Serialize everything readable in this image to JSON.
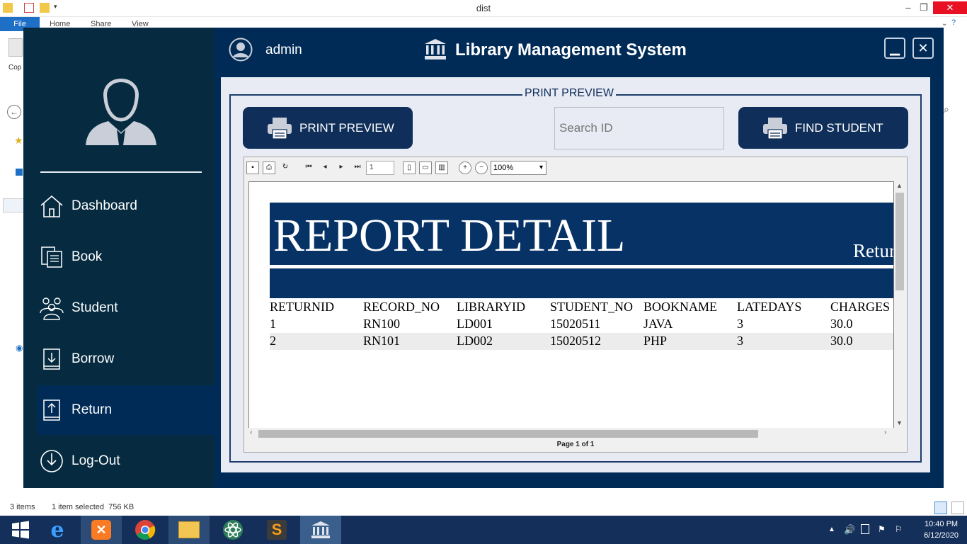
{
  "explorer": {
    "window_title": "dist",
    "ribbon_tabs": [
      "File",
      "Home",
      "Share",
      "View"
    ],
    "partial_label": "Cop",
    "status_items": "3 items",
    "status_selected": "1 item selected  756 KB",
    "min_label": "–",
    "max_label": "❐",
    "close_label": "✕"
  },
  "taskbar": {
    "time": "10:40 PM",
    "date": "6/12/2020",
    "apps": [
      "start-button",
      "internet-explorer-icon",
      "xampp-icon",
      "chrome-icon",
      "file-explorer-icon",
      "atom-icon",
      "sublime-icon",
      "library-app-icon"
    ]
  },
  "app": {
    "username": "admin",
    "title": "Library Management System",
    "minimize_label": "▁",
    "close_label": "✕",
    "nav": [
      {
        "label": "Dashboard",
        "icon": "home-icon"
      },
      {
        "label": "Book",
        "icon": "book-icon"
      },
      {
        "label": "Student",
        "icon": "students-icon"
      },
      {
        "label": "Borrow",
        "icon": "borrow-icon"
      },
      {
        "label": "Return",
        "icon": "return-icon",
        "active": true
      },
      {
        "label": "Log-Out",
        "icon": "logout-icon"
      }
    ],
    "group_title": "PRINT PREVIEW",
    "print_preview_button": "PRINT PREVIEW",
    "find_student_button": "FIND STUDENT",
    "search_placeholder": "Search ID"
  },
  "viewer": {
    "page_number": "1",
    "zoom": "100%",
    "page_status": "Page 1 of 1"
  },
  "report": {
    "title": "REPORT DETAIL",
    "subtitle": "Retur",
    "columns": [
      "RETURNID",
      "RECORD_NO",
      "LIBRARYID",
      "STUDENT_NO",
      "BOOKNAME",
      "LATEDAYS",
      "CHARGES"
    ],
    "rows": [
      [
        "1",
        "RN100",
        "LD001",
        "15020511",
        "JAVA",
        "3",
        "30.0"
      ],
      [
        "2",
        "RN101",
        "LD002",
        "15020512",
        "PHP",
        "3",
        "30.0"
      ]
    ]
  },
  "colors": {
    "sidebar": "#062b40",
    "header": "#002b57",
    "band": "#073266",
    "accent_button": "#0f2f5a"
  }
}
